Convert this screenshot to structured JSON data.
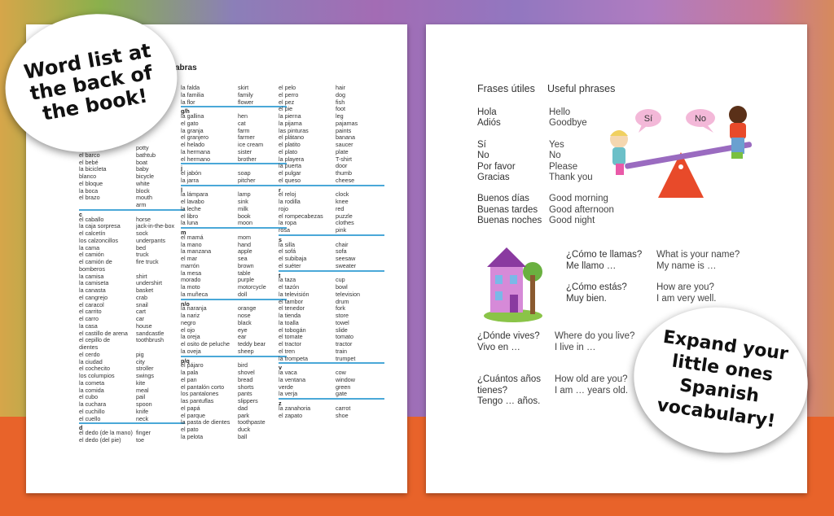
{
  "callouts": {
    "left": [
      "Word list at",
      "the back of",
      "the book!"
    ],
    "right": [
      "Expand your",
      "little ones",
      "Spanish",
      "vocabulary!"
    ]
  },
  "wordlist": {
    "title_fragment": "abras",
    "col1": [
      [
        "el banero",
        "potty"
      ],
      [
        "el barco",
        "bathtub"
      ],
      [
        "el bebé",
        "boat"
      ],
      [
        "la bicicleta",
        "baby"
      ],
      [
        "blanco",
        "bicycle"
      ],
      [
        "el bloque",
        "white"
      ],
      [
        "la boca",
        "block"
      ],
      [
        "el brazo",
        "mouth"
      ],
      [
        "",
        "arm"
      ],
      [
        "#c",
        ""
      ],
      [
        "el caballo",
        "horse"
      ],
      [
        "la caja sorpresa",
        "jack-in-the-box"
      ],
      [
        "el calcetín",
        "sock"
      ],
      [
        "los calzoncillos",
        "underpants"
      ],
      [
        "la cama",
        "bed"
      ],
      [
        "el camión",
        "truck"
      ],
      [
        "el camión de",
        "fire truck"
      ],
      [
        "bomberos",
        ""
      ],
      [
        "la camisa",
        "shirt"
      ],
      [
        "la camiseta",
        "undershirt"
      ],
      [
        "la canasta",
        "basket"
      ],
      [
        "el cangrejo",
        "crab"
      ],
      [
        "el caracol",
        "snail"
      ],
      [
        "el carrito",
        "cart"
      ],
      [
        "el carro",
        "car"
      ],
      [
        "la casa",
        "house"
      ],
      [
        "el castillo de arena",
        "sandcastle"
      ],
      [
        "el cepillo de",
        "toothbrush"
      ],
      [
        "dientes",
        ""
      ],
      [
        "el cerdo",
        "pig"
      ],
      [
        "la ciudad",
        "city"
      ],
      [
        "el cochecito",
        "stroller"
      ],
      [
        "los columpios",
        "swings"
      ],
      [
        "la cometa",
        "kite"
      ],
      [
        "la comida",
        "meal"
      ],
      [
        "el cubo",
        "pail"
      ],
      [
        "la cuchara",
        "spoon"
      ],
      [
        "el cuchillo",
        "knife"
      ],
      [
        "el cuello",
        "neck"
      ],
      [
        "#d",
        ""
      ],
      [
        "el dedo (de la mano)",
        "finger"
      ],
      [
        "el dedo (del pie)",
        "toe"
      ]
    ],
    "col2": [
      [
        "la falda",
        "skirt"
      ],
      [
        "la familia",
        "family"
      ],
      [
        "la flor",
        "flower"
      ],
      [
        "#g/h",
        ""
      ],
      [
        "la gallina",
        "hen"
      ],
      [
        "el gato",
        "cat"
      ],
      [
        "la granja",
        "farm"
      ],
      [
        "el granjero",
        "farmer"
      ],
      [
        "el helado",
        "ice cream"
      ],
      [
        "la hermana",
        "sister"
      ],
      [
        "el hermano",
        "brother"
      ],
      [
        "#j",
        ""
      ],
      [
        "el jabón",
        "soap"
      ],
      [
        "la jarra",
        "pitcher"
      ],
      [
        "#l",
        ""
      ],
      [
        "la lámpara",
        "lamp"
      ],
      [
        "el lavabo",
        "sink"
      ],
      [
        "la leche",
        "milk"
      ],
      [
        "el libro",
        "book"
      ],
      [
        "la luna",
        "moon"
      ],
      [
        "#m",
        ""
      ],
      [
        "el mamá",
        "mom"
      ],
      [
        "la mano",
        "hand"
      ],
      [
        "la manzana",
        "apple"
      ],
      [
        "el mar",
        "sea"
      ],
      [
        "marrón",
        "brown"
      ],
      [
        "la mesa",
        "table"
      ],
      [
        "morado",
        "purple"
      ],
      [
        "la moto",
        "motorcycle"
      ],
      [
        "la muñeca",
        "doll"
      ],
      [
        "#n/o",
        ""
      ],
      [
        "la naranja",
        "orange"
      ],
      [
        "la nariz",
        "nose"
      ],
      [
        "negro",
        "black"
      ],
      [
        "el ojo",
        "eye"
      ],
      [
        "la oreja",
        "ear"
      ],
      [
        "el osito de peluche",
        "teddy bear"
      ],
      [
        "la oveja",
        "sheep"
      ],
      [
        "#p/q",
        ""
      ],
      [
        "el pájaro",
        "bird"
      ],
      [
        "la pala",
        "shovel"
      ],
      [
        "el pan",
        "bread"
      ],
      [
        "el pantalón corto",
        "shorts"
      ],
      [
        "los pantalones",
        "pants"
      ],
      [
        "las pantuflas",
        "slippers"
      ],
      [
        "el papá",
        "dad"
      ],
      [
        "el parque",
        "park"
      ],
      [
        "la pasta de dientes",
        "toothpaste"
      ],
      [
        "el pato",
        "duck"
      ],
      [
        "la pelota",
        "ball"
      ]
    ],
    "col3": [
      [
        "el pelo",
        "hair"
      ],
      [
        "el perro",
        "dog"
      ],
      [
        "el pez",
        "fish"
      ],
      [
        "el pie",
        "foot"
      ],
      [
        "la pierna",
        "leg"
      ],
      [
        "la pijama",
        "pajamas"
      ],
      [
        "las pinturas",
        "paints"
      ],
      [
        "el plátano",
        "banana"
      ],
      [
        "el platito",
        "saucer"
      ],
      [
        "el plato",
        "plate"
      ],
      [
        "la playera",
        "T-shirt"
      ],
      [
        "la puerta",
        "door"
      ],
      [
        "el pulgar",
        "thumb"
      ],
      [
        "el queso",
        "cheese"
      ],
      [
        "#r",
        ""
      ],
      [
        "el reloj",
        "clock"
      ],
      [
        "la rodilla",
        "knee"
      ],
      [
        "rojo",
        "red"
      ],
      [
        "el rompecabezas",
        "puzzle"
      ],
      [
        "la ropa",
        "clothes"
      ],
      [
        "rosa",
        "pink"
      ],
      [
        "#s",
        ""
      ],
      [
        "la silla",
        "chair"
      ],
      [
        "el sofá",
        "sofa"
      ],
      [
        "el subibaja",
        "seesaw"
      ],
      [
        "el suéter",
        "sweater"
      ],
      [
        "#t",
        ""
      ],
      [
        "la taza",
        "cup"
      ],
      [
        "el tazón",
        "bowl"
      ],
      [
        "la televisión",
        "television"
      ],
      [
        "el tambor",
        "drum"
      ],
      [
        "el tenedor",
        "fork"
      ],
      [
        "la tienda",
        "store"
      ],
      [
        "la toalla",
        "towel"
      ],
      [
        "el tobogán",
        "slide"
      ],
      [
        "el tomate",
        "tomato"
      ],
      [
        "el tractor",
        "tractor"
      ],
      [
        "el tren",
        "train"
      ],
      [
        "la trompeta",
        "trumpet"
      ],
      [
        "#v",
        ""
      ],
      [
        "la vaca",
        "cow"
      ],
      [
        "la ventana",
        "window"
      ],
      [
        "verde",
        "green"
      ],
      [
        "la verja",
        "gate"
      ],
      [
        "#z",
        ""
      ],
      [
        "la zanahoria",
        "carrot"
      ],
      [
        "el zapato",
        "shoe"
      ]
    ]
  },
  "phrases": {
    "heading_es": "Frases útiles",
    "heading_en": "Useful phrases",
    "basic": [
      [
        "Hola",
        "Hello"
      ],
      [
        "Adiós",
        "Goodbye"
      ],
      [
        "",
        ""
      ],
      [
        "Sí",
        "Yes"
      ],
      [
        "No",
        "No"
      ],
      [
        "Por favor",
        "Please"
      ],
      [
        "Gracias",
        "Thank you"
      ],
      [
        "",
        ""
      ],
      [
        "Buenos días",
        "Good morning"
      ],
      [
        "Buenas tardes",
        "Good afternoon"
      ],
      [
        "Buenas noches",
        "Good night"
      ]
    ],
    "q1_es": [
      "¿Cómo te llamas?",
      "Me llamo …"
    ],
    "q1_en": [
      "What is your name?",
      "My name is …"
    ],
    "q2_es": [
      "¿Cómo estás?",
      "Muy bien."
    ],
    "q2_en": [
      "How are you?",
      "I am very well."
    ],
    "q3_es": [
      "¿Dónde vives?",
      "Vivo en …"
    ],
    "q3_en": [
      "Where do you live?",
      "I live in …"
    ],
    "q4_es": [
      "¿Cuántos años",
      "tienes?",
      "Tengo … años."
    ],
    "q4_en": [
      "How old are you?",
      "",
      "I am … years old."
    ],
    "speech_si": "Sí",
    "speech_no": "No"
  }
}
